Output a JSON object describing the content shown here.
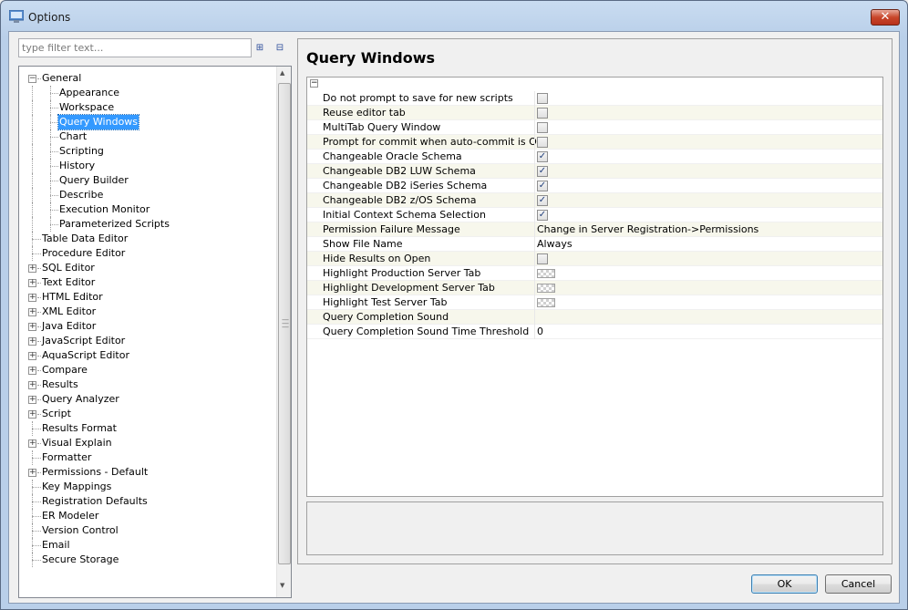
{
  "window": {
    "title": "Options",
    "close_label": "✕"
  },
  "filter": {
    "placeholder": "type filter text...",
    "expand_label": "⊞",
    "collapse_label": "⊟"
  },
  "tree": {
    "items": [
      {
        "label": "General",
        "level": 0,
        "expander": "−"
      },
      {
        "label": "Appearance",
        "level": 1
      },
      {
        "label": "Workspace",
        "level": 1
      },
      {
        "label": "Query Windows",
        "level": 1,
        "selected": true
      },
      {
        "label": "Chart",
        "level": 1
      },
      {
        "label": "Scripting",
        "level": 1
      },
      {
        "label": "History",
        "level": 1
      },
      {
        "label": "Query Builder",
        "level": 1
      },
      {
        "label": "Describe",
        "level": 1
      },
      {
        "label": "Execution Monitor",
        "level": 1
      },
      {
        "label": "Parameterized Scripts",
        "level": 1
      },
      {
        "label": "Table Data Editor",
        "level": 0
      },
      {
        "label": "Procedure Editor",
        "level": 0
      },
      {
        "label": "SQL Editor",
        "level": 0,
        "expander": "+"
      },
      {
        "label": "Text Editor",
        "level": 0,
        "expander": "+"
      },
      {
        "label": "HTML Editor",
        "level": 0,
        "expander": "+"
      },
      {
        "label": "XML Editor",
        "level": 0,
        "expander": "+"
      },
      {
        "label": "Java Editor",
        "level": 0,
        "expander": "+"
      },
      {
        "label": "JavaScript Editor",
        "level": 0,
        "expander": "+"
      },
      {
        "label": "AquaScript Editor",
        "level": 0,
        "expander": "+"
      },
      {
        "label": "Compare",
        "level": 0,
        "expander": "+"
      },
      {
        "label": "Results",
        "level": 0,
        "expander": "+"
      },
      {
        "label": "Query Analyzer",
        "level": 0,
        "expander": "+"
      },
      {
        "label": "Script",
        "level": 0,
        "expander": "+"
      },
      {
        "label": "Results Format",
        "level": 0
      },
      {
        "label": "Visual Explain",
        "level": 0,
        "expander": "+"
      },
      {
        "label": "Formatter",
        "level": 0
      },
      {
        "label": "Permissions - Default",
        "level": 0,
        "expander": "+"
      },
      {
        "label": "Key Mappings",
        "level": 0
      },
      {
        "label": "Registration Defaults",
        "level": 0
      },
      {
        "label": "ER Modeler",
        "level": 0
      },
      {
        "label": "Version Control",
        "level": 0
      },
      {
        "label": "Email",
        "level": 0
      },
      {
        "label": "Secure Storage",
        "level": 0
      }
    ]
  },
  "page": {
    "title": "Query Windows",
    "collapse_label": "−"
  },
  "properties": [
    {
      "name": "Do not prompt to save for new scripts",
      "type": "checkbox",
      "checked": false
    },
    {
      "name": "Reuse editor tab",
      "type": "checkbox",
      "checked": false
    },
    {
      "name": "MultiTab Query Window",
      "type": "checkbox",
      "checked": false
    },
    {
      "name": "Prompt for commit when auto-commit is OFF",
      "type": "checkbox",
      "checked": false
    },
    {
      "name": "Changeable Oracle Schema",
      "type": "checkbox",
      "checked": true
    },
    {
      "name": "Changeable DB2 LUW Schema",
      "type": "checkbox",
      "checked": true
    },
    {
      "name": "Changeable DB2 iSeries Schema",
      "type": "checkbox",
      "checked": true
    },
    {
      "name": "Changeable DB2 z/OS Schema",
      "type": "checkbox",
      "checked": true
    },
    {
      "name": "Initial Context Schema Selection",
      "type": "checkbox",
      "checked": true
    },
    {
      "name": "Permission Failure Message",
      "type": "text",
      "value": "Change in Server Registration->Permissions"
    },
    {
      "name": "Show File Name",
      "type": "text",
      "value": "Always"
    },
    {
      "name": "Hide Results on Open",
      "type": "checkbox",
      "checked": false
    },
    {
      "name": "Highlight Production Server Tab",
      "type": "color"
    },
    {
      "name": "Highlight Development Server Tab",
      "type": "color"
    },
    {
      "name": "Highlight Test Server Tab",
      "type": "color"
    },
    {
      "name": "Query Completion Sound",
      "type": "text",
      "value": ""
    },
    {
      "name": "Query Completion Sound Time Threshold",
      "type": "text",
      "value": "0"
    }
  ],
  "buttons": {
    "ok": "OK",
    "cancel": "Cancel"
  },
  "colors": {
    "selection": "#3399ff",
    "close_button": "#c8462a",
    "title_bar": "#b9cfe9"
  }
}
